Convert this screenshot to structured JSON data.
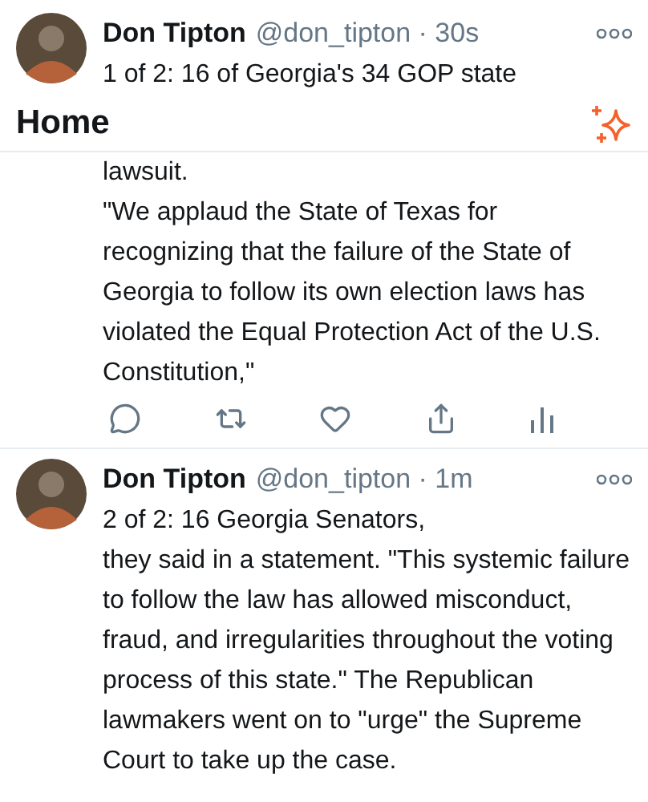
{
  "header": {
    "title": "Home"
  },
  "tweets": [
    {
      "name": "Don Tipton",
      "meta": "@don_tipton · 30s",
      "text_lines": [
        "1 of 2: 16 of Georgia's 34 GOP state",
        "lawsuit.",
        "\"We applaud the State of Texas for recognizing that the failure of the State of Georgia to follow its own election laws has violated the Equal Protection Act of the U.S. Constitution,\""
      ],
      "actions": true
    },
    {
      "name": "Don Tipton",
      "meta": "@don_tipton · 1m",
      "text_lines": [
        "2 of 2: 16 Georgia Senators,",
        "they said in a statement. \"This systemic failure to follow the law has allowed misconduct, fraud, and irregularities throughout the voting process of this state.\" The Republican lawmakers went on to \"urge\" the Supreme Court to take up the case."
      ],
      "actions": false
    }
  ]
}
